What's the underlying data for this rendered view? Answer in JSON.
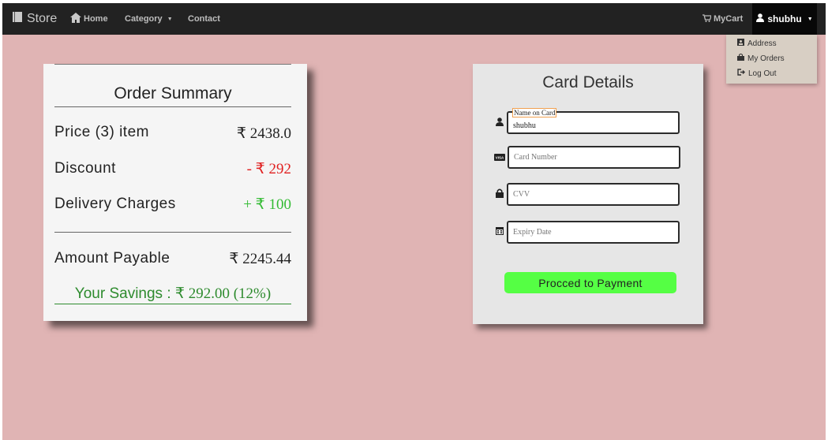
{
  "navbar": {
    "brand": "Store",
    "home": "Home",
    "category": "Category",
    "contact": "Contact",
    "cart": "MyCart",
    "user": "shubhu"
  },
  "user_menu": [
    "Address",
    "My Orders",
    "Log Out"
  ],
  "order_summary": {
    "title": "Order Summary",
    "rows": [
      {
        "label": "Price (3) item",
        "value": "₹ 2438.0",
        "color": "#222222"
      },
      {
        "label": "Discount",
        "value": "- ₹ 292",
        "color": "#e02020"
      },
      {
        "label": "Delivery Charges",
        "value": "+ ₹ 100",
        "color": "#33bb33"
      }
    ],
    "payable_label": "Amount Payable",
    "payable_value": "₹ 2245.44",
    "savings_label": "Your Savings :",
    "savings_value": "₹ 292.00 (12%)"
  },
  "card_details": {
    "title": "Card Details",
    "name_label": "Name on Card",
    "name_value": "shubhu",
    "card_number_placeholder": "Card Number",
    "cvv_placeholder": "CVV",
    "expiry_placeholder": "Expiry Date",
    "button": "Procced to Payment"
  },
  "colors": {
    "background": "#e0b4b4",
    "navbar": "#222222",
    "button": "#55ff44",
    "savings": "#2e8b2e"
  },
  "icons": [
    "book-icon",
    "home-icon",
    "cart-icon",
    "user-icon",
    "address-book-icon",
    "shopping-bag-icon",
    "logout-icon",
    "visa-card-icon",
    "lock-icon",
    "calendar-icon"
  ]
}
